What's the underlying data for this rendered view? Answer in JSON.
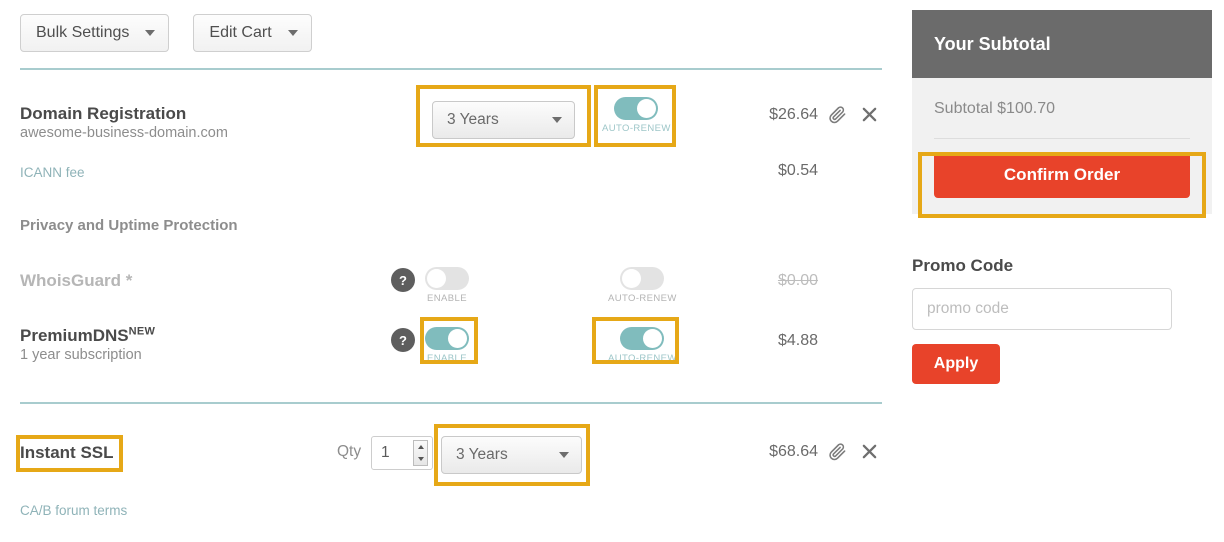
{
  "toolbar": {
    "bulk_settings": "Bulk Settings",
    "edit_cart": "Edit Cart"
  },
  "cart": {
    "domain": {
      "title": "Domain Registration",
      "subtitle": "awesome-business-domain.com",
      "icann_link": "ICANN fee",
      "term": "3 Years",
      "autorenew_label": "AUTO-RENEW",
      "price": "$26.64",
      "icann_price": "$0.54",
      "edit_icon": "paperclip-icon",
      "remove_icon": "close-icon"
    },
    "protection_header": "Privacy and Uptime Protection",
    "whoisguard": {
      "title": "WhoisGuard *",
      "help": "?",
      "enable_label": "ENABLE",
      "autorenew_label": "AUTO-RENEW",
      "price": "$0.00"
    },
    "premiumdns": {
      "title": "PremiumDNS",
      "badge": "NEW",
      "subtitle": "1 year subscription",
      "help": "?",
      "enable_label": "ENABLE",
      "autorenew_label": "AUTO-RENEW",
      "price": "$4.88"
    },
    "ssl": {
      "title": "Instant SSL",
      "terms_link": "CA/B forum terms",
      "qty_label": "Qty",
      "qty_value": "1",
      "term": "3 Years",
      "price": "$68.64",
      "edit_icon": "paperclip-icon",
      "remove_icon": "close-icon"
    }
  },
  "aside": {
    "panel_title": "Your Subtotal",
    "subtotal_line": "Subtotal $100.70",
    "confirm_label": "Confirm Order",
    "promo_title": "Promo Code",
    "promo_placeholder": "promo code",
    "apply_label": "Apply"
  },
  "colors": {
    "accent_teal": "#80bcbd",
    "highlight_gold": "#e6a817",
    "action_red": "#e8432a",
    "panel_header": "#6b6b6b"
  }
}
